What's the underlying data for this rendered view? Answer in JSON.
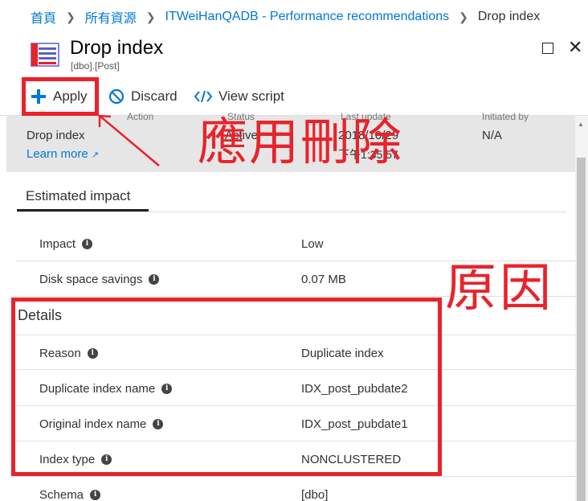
{
  "breadcrumb": {
    "items": [
      "首頁",
      "所有資源",
      "ITWeiHanQADB - Performance recommendations"
    ],
    "current": "Drop index"
  },
  "blade": {
    "title": "Drop index",
    "subtitle": "[dbo].[Post]",
    "icon": "table-icon"
  },
  "toolbar": {
    "apply_label": "Apply",
    "discard_label": "Discard",
    "view_script_label": "View script"
  },
  "info": {
    "headers": [
      "Action",
      "Status",
      "Last update",
      "Initiated by"
    ],
    "action": "Drop index",
    "learn_more": "Learn more",
    "status": "Active",
    "last_update_date": "2018/10/29",
    "last_update_time": "下午1:35:57",
    "initiated_by": "N/A"
  },
  "tab": {
    "label": "Estimated impact"
  },
  "impact": [
    {
      "key": "Impact",
      "value": "Low"
    },
    {
      "key": "Disk space savings",
      "value": "0.07 MB"
    }
  ],
  "details": {
    "title": "Details",
    "rows": [
      {
        "key": "Reason",
        "value": "Duplicate index"
      },
      {
        "key": "Duplicate index name",
        "value": "IDX_post_pubdate2"
      },
      {
        "key": "Original index name",
        "value": "IDX_post_pubdate1"
      },
      {
        "key": "Index type",
        "value": "NONCLUSTERED"
      },
      {
        "key": "Schema",
        "value": "[dbo]"
      }
    ]
  },
  "annotations": {
    "apply_note": "應用刪除",
    "reason_note": "原因",
    "color": "#e8232b"
  },
  "colors": {
    "accent": "#0078d4",
    "highlight": "#e8232b"
  }
}
